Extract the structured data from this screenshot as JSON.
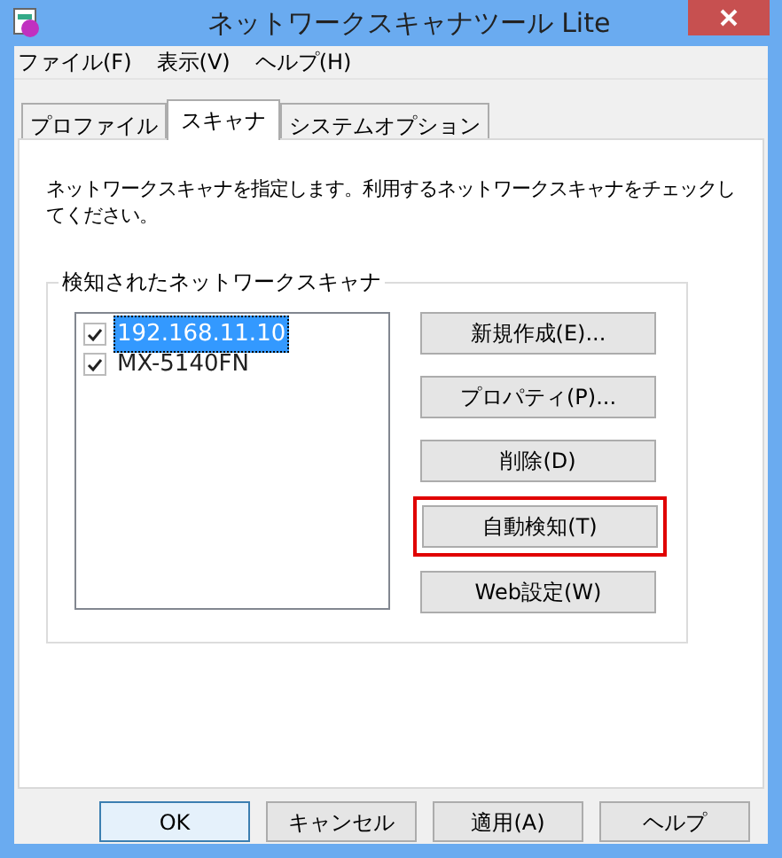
{
  "window": {
    "title": "ネットワークスキャナツール Lite"
  },
  "menu": [
    "ファイル(F)",
    "表示(V)",
    "ヘルプ(H)"
  ],
  "tabs": [
    {
      "label": "プロファイル",
      "selected": false
    },
    {
      "label": "スキャナ",
      "selected": true
    },
    {
      "label": "システムオプション",
      "selected": false
    }
  ],
  "description": "ネットワークスキャナを指定します。利用するネットワークスキャナをチェックしてください。",
  "group": {
    "title": "検知されたネットワークスキャナ",
    "scanners": [
      {
        "name": "192.168.11.10",
        "checked": true,
        "selected": true
      },
      {
        "name": "MX-5140FN",
        "checked": true,
        "selected": false
      }
    ],
    "buttons": [
      {
        "label": "新規作成(E)...",
        "highlighted": false
      },
      {
        "label": "プロパティ(P)...",
        "highlighted": false
      },
      {
        "label": "削除(D)",
        "highlighted": false
      },
      {
        "label": "自動検知(T)",
        "highlighted": true
      },
      {
        "label": "Web設定(W)",
        "highlighted": false
      }
    ]
  },
  "footer_buttons": [
    {
      "label": "OK",
      "default": true
    },
    {
      "label": "キャンセル",
      "default": false
    },
    {
      "label": "適用(A)",
      "default": false
    },
    {
      "label": "ヘルプ",
      "default": false
    }
  ]
}
